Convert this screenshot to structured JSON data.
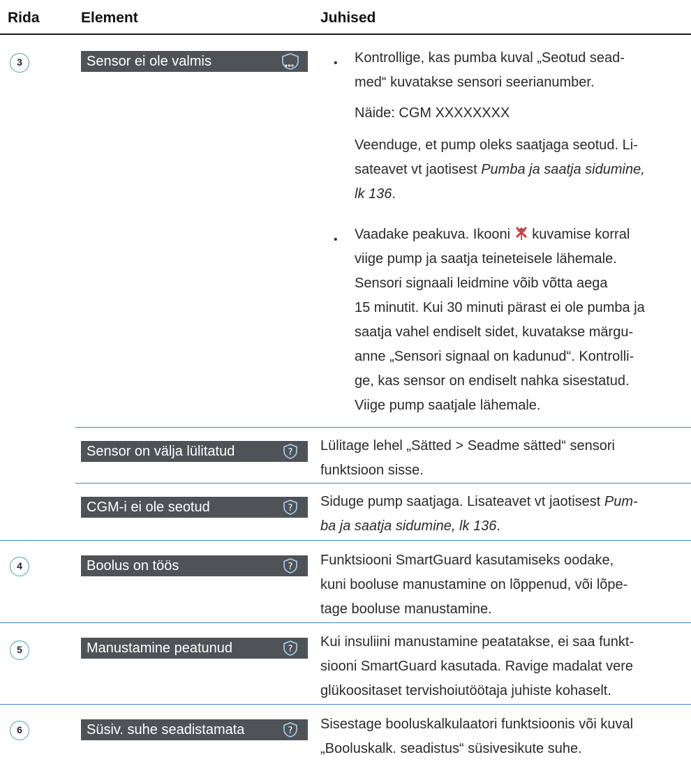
{
  "header": {
    "col_row": "Rida",
    "col_element": "Element",
    "col_instructions": "Juhised"
  },
  "rows": {
    "r3": {
      "badge": "3",
      "bar_label": "Sensor ei ole valmis",
      "b1_line1": "Kontrollige, kas pumba kuval „Seotud sead-",
      "b1_line2": "med“ kuvatakse sensori seerianumber.",
      "example": "Näide: CGM XXXXXXXX",
      "ensure_line1": "Veenduge, et pump oleks saatjaga seotud. Li-",
      "ensure_line2a": "sateavet vt jaotisest ",
      "ensure_line2b": "Pumba ja saatja sidumine,",
      "ensure_line3a": "lk 136",
      "ensure_line3b": ".",
      "b2_line1a": "Vaadake peakuva. Ikooni ",
      "b2_line1b": " kuvamise korral",
      "b2_line2": "viige pump ja saatja teineteisele lähemale.",
      "b2_line3": "Sensori signaali leidmine võib võtta aega",
      "b2_line4": "15 minutit. Kui 30 minuti pärast ei ole pumba ja",
      "b2_line5": "saatja vahel endiselt sidet, kuvatakse märgu-",
      "b2_line6": "anne „Sensori signaal on kadunud“. Kontrolli-",
      "b2_line7": "ge, kas sensor on endiselt nahka sisestatud.",
      "b2_line8": "Viige pump saatjale lähemale."
    },
    "r3b": {
      "bar_label": "Sensor on välja lülitatud",
      "line1": "Lülitage lehel „Sätted > Seadme sätted“ sensori",
      "line2": "funktsioon sisse."
    },
    "r3c": {
      "bar_label": "CGM-i ei ole seotud",
      "line1a": "Siduge pump saatjaga. Lisateavet vt jaotisest ",
      "line1b": "Pum-",
      "line2a": "ba ja saatja sidumine, lk 136",
      "line2b": "."
    },
    "r4": {
      "badge": "4",
      "bar_label": "Boolus on töös",
      "line1": "Funktsiooni SmartGuard kasutamiseks oodake,",
      "line2": "kuni booluse manustamine on lõppenud, või lõpe-",
      "line3": "tage booluse manustamine."
    },
    "r5": {
      "badge": "5",
      "bar_label": "Manustamine peatunud",
      "line1": "Kui insuliini manustamine peatatakse, ei saa funkt-",
      "line2": "siooni SmartGuard kasutada. Ravige madalat vere",
      "line3": "glükoositaset tervishoiutöötaja juhiste kohaselt."
    },
    "r6": {
      "badge": "6",
      "bar_label": "Süsiv. suhe seadistamata",
      "line1": "Sisestage booluskalkulaatori funktsioonis või kuval",
      "line2": "„Booluskalk. seadistus“ süsivesikute suhe."
    }
  },
  "colors": {
    "bar_bg": "#4f5256",
    "separator": "#3f86c1",
    "badge_ring": "#4aa5a8",
    "shield": "#9cc8e6",
    "alert_icon": "#e0353a"
  },
  "icons": {
    "status_icon": "shield-dots-icon",
    "help_icon": "question-icon",
    "lost_signal_icon": "sensor-signal-lost-icon"
  }
}
